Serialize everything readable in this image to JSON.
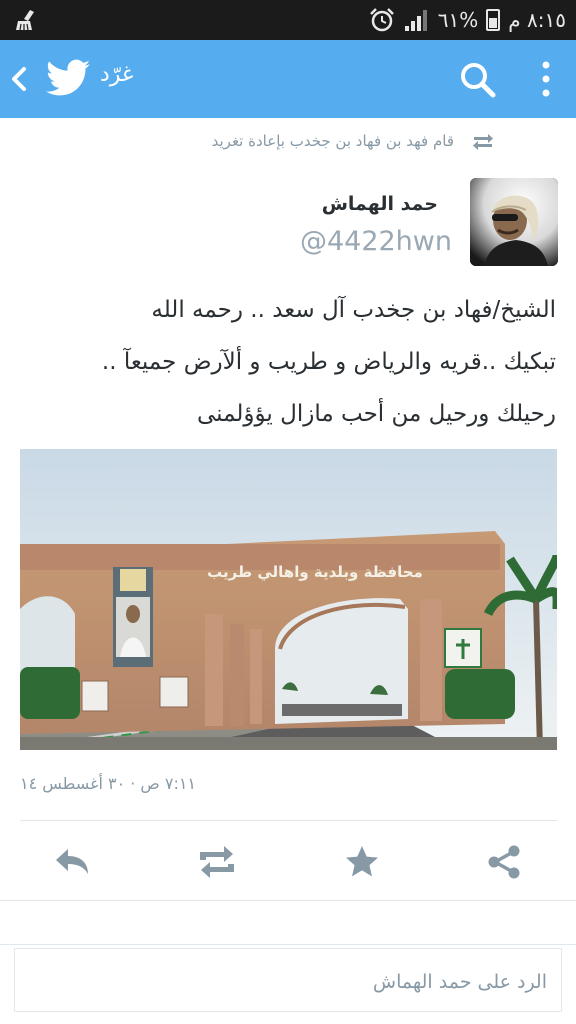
{
  "status_bar": {
    "time": "٨:١٥ م",
    "battery": "٦١%",
    "battery_level": 0.61,
    "icons": [
      "broom-icon",
      "alarm-clock-icon",
      "signal-bars-icon",
      "battery-icon"
    ]
  },
  "app_bar": {
    "title": "غرّد",
    "icons": [
      "back-arrow-icon",
      "twitter-bird-icon",
      "search-icon",
      "overflow-menu-icon"
    ],
    "color": "#55acee"
  },
  "retweet_context": {
    "text": "قام فهد بن فهاد بن جخدب بإعادة تغريد",
    "icon": "retweet-icon"
  },
  "tweet": {
    "author_name": "حمد الهماش",
    "author_handle": "@4422hwn",
    "text_lines": [
      "الشيخ/فهاد بن جخدب آل سعد .. رحمه الله",
      "تبكيك ..قريه والرياض و طريب و ألآرض جميعآ ..",
      "رحيلك ورحيل من أحب مازال يؤؤلمنى"
    ],
    "photo_sign_text": "محافظة وبلدية واهالي طريب",
    "timestamp": "٧:١١ ص · ٣٠ أغسطس ١٤"
  },
  "actions": [
    {
      "name": "reply",
      "icon": "reply-icon"
    },
    {
      "name": "retweet",
      "icon": "retweet-icon"
    },
    {
      "name": "favorite",
      "icon": "star-icon"
    },
    {
      "name": "share",
      "icon": "share-icon"
    }
  ],
  "reply_box": {
    "placeholder": "الرد على  حمد الهماش"
  }
}
